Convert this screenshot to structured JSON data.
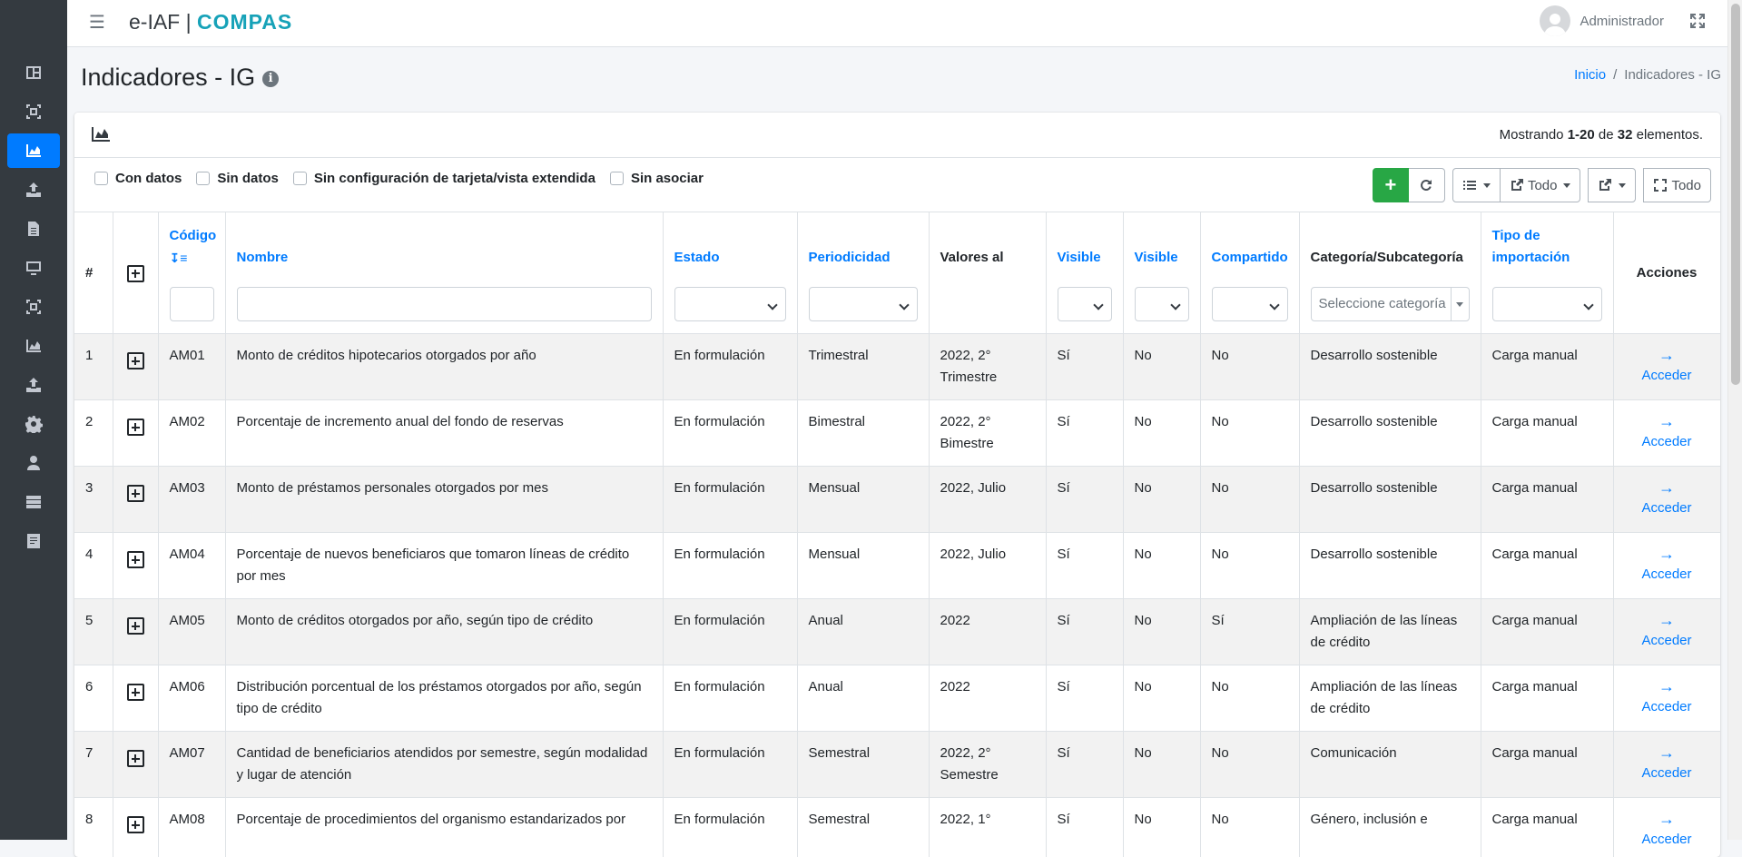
{
  "app": {
    "brand_main": "e-IAF",
    "brand_sep": "|",
    "brand_product": "COMPAS",
    "user_name": "Administrador"
  },
  "sidebar": {
    "items": [
      {
        "icon": "dashboard-icon"
      },
      {
        "icon": "frame-icon"
      },
      {
        "icon": "area-chart-icon",
        "active": true
      },
      {
        "icon": "upload-icon"
      },
      {
        "icon": "document-icon"
      },
      {
        "icon": "monitor-icon"
      },
      {
        "icon": "frame-icon"
      },
      {
        "icon": "area-chart-icon"
      },
      {
        "icon": "upload-icon"
      },
      {
        "icon": "gear-icon"
      },
      {
        "icon": "user-icon"
      },
      {
        "icon": "server-icon"
      },
      {
        "icon": "form-icon"
      }
    ]
  },
  "header": {
    "title": "Indicadores - IG",
    "info_glyph": "i",
    "breadcrumb_home": "Inicio",
    "breadcrumb_sep": "/",
    "breadcrumb_current": "Indicadores - IG"
  },
  "summary": {
    "prefix": "Mostrando ",
    "range": "1-20",
    "middle": " de ",
    "total": "32",
    "suffix": " elementos."
  },
  "filters": {
    "con_datos": "Con datos",
    "sin_datos": "Sin datos",
    "sin_config": "Sin configuración de tarjeta/vista extendida",
    "sin_asociar": "Sin asociar"
  },
  "toolbar": {
    "add_glyph": "+",
    "todo_label": "Todo",
    "fullscreen_label": "Todo"
  },
  "table": {
    "headers": {
      "num": "#",
      "codigo": "Código",
      "nombre": "Nombre",
      "estado": "Estado",
      "periodicidad": "Periodicidad",
      "valores_al": "Valores al",
      "visible1": "Visible",
      "visible2": "Visible",
      "compartido": "Compartido",
      "categoria": "Categoría/Subcategoría",
      "tipo_importacion": "Tipo de importación",
      "acciones": "Acciones"
    },
    "categoria_placeholder": "Seleccione categoría",
    "action_label": "Acceder",
    "rows": [
      {
        "n": "1",
        "codigo": "AM01",
        "nombre": "Monto de créditos hipotecarios otorgados por año",
        "estado": "En formulación",
        "periodicidad": "Trimestral",
        "valores_al": "2022, 2° Trimestre",
        "visible1": "Sí",
        "visible2": "No",
        "compartido": "No",
        "categoria": "Desarrollo sostenible",
        "tipo": "Carga manual"
      },
      {
        "n": "2",
        "codigo": "AM02",
        "nombre": "Porcentaje de incremento anual del fondo de reservas",
        "estado": "En formulación",
        "periodicidad": "Bimestral",
        "valores_al": "2022, 2° Bimestre",
        "visible1": "Sí",
        "visible2": "No",
        "compartido": "No",
        "categoria": "Desarrollo sostenible",
        "tipo": "Carga manual"
      },
      {
        "n": "3",
        "codigo": "AM03",
        "nombre": "Monto de préstamos personales otorgados por mes",
        "estado": "En formulación",
        "periodicidad": "Mensual",
        "valores_al": "2022, Julio",
        "visible1": "Sí",
        "visible2": "No",
        "compartido": "No",
        "categoria": "Desarrollo sostenible",
        "tipo": "Carga manual"
      },
      {
        "n": "4",
        "codigo": "AM04",
        "nombre": "Porcentaje de nuevos beneficiaros que tomaron líneas de crédito por mes",
        "estado": "En formulación",
        "periodicidad": "Mensual",
        "valores_al": "2022, Julio",
        "visible1": "Sí",
        "visible2": "No",
        "compartido": "No",
        "categoria": "Desarrollo sostenible",
        "tipo": "Carga manual"
      },
      {
        "n": "5",
        "codigo": "AM05",
        "nombre": "Monto de créditos otorgados por año, según tipo de crédito",
        "estado": "En formulación",
        "periodicidad": "Anual",
        "valores_al": "2022",
        "visible1": "Sí",
        "visible2": "No",
        "compartido": "Sí",
        "categoria": "Ampliación de las líneas de crédito",
        "tipo": "Carga manual"
      },
      {
        "n": "6",
        "codigo": "AM06",
        "nombre": "Distribución porcentual de los préstamos otorgados por año, según tipo de crédito",
        "estado": "En formulación",
        "periodicidad": "Anual",
        "valores_al": "2022",
        "visible1": "Sí",
        "visible2": "No",
        "compartido": "No",
        "categoria": "Ampliación de las líneas de crédito",
        "tipo": "Carga manual"
      },
      {
        "n": "7",
        "codigo": "AM07",
        "nombre": "Cantidad de beneficiarios atendidos por semestre, según modalidad y lugar de atención",
        "estado": "En formulación",
        "periodicidad": "Semestral",
        "valores_al": "2022, 2° Semestre",
        "visible1": "Sí",
        "visible2": "No",
        "compartido": "No",
        "categoria": "Comunicación",
        "tipo": "Carga manual"
      },
      {
        "n": "8",
        "codigo": "AM08",
        "nombre": "Porcentaje de procedimientos del organismo estandarizados por",
        "estado": "En formulación",
        "periodicidad": "Semestral",
        "valores_al": "2022, 1°",
        "visible1": "Sí",
        "visible2": "No",
        "compartido": "No",
        "categoria": "Género, inclusión e",
        "tipo": "Carga manual"
      }
    ]
  }
}
